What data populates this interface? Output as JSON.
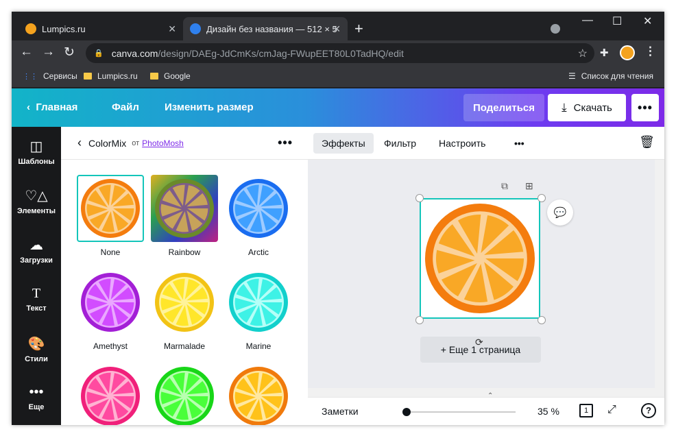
{
  "browser": {
    "tabs": [
      {
        "title": "Lumpics.ru",
        "icon": "lumpics-favicon"
      },
      {
        "title": "Дизайн без названия — 512 × 5",
        "icon": "canva-favicon"
      }
    ],
    "url_host": "canva.com",
    "url_path": "/design/DAEg-JdCmKs/cmJag-FWupEET80L0TadHQ/edit",
    "bookmarks": [
      "Сервисы",
      "Lumpics.ru",
      "Google"
    ],
    "reading_list": "Список для чтения"
  },
  "header": {
    "home": "Главная",
    "file": "Файл",
    "resize": "Изменить размер",
    "share": "Поделиться",
    "download": "Скачать"
  },
  "rail": [
    "Шаблоны",
    "Элементы",
    "Загрузки",
    "Текст",
    "Стили",
    "Еще"
  ],
  "panel": {
    "title": "ColorMix",
    "by": "от",
    "author": "PhotoMosh",
    "effects": [
      {
        "name": "None",
        "rind": "#f47c0e",
        "flesh": "#f9a826",
        "bg": "#fbd29a"
      },
      {
        "name": "Rainbow",
        "rind": "#6a8a2a",
        "flesh": "#c7a35a",
        "bg": "#7d5c8a"
      },
      {
        "name": "Arctic",
        "rind": "#1a6df0",
        "flesh": "#3fa0ff",
        "bg": "#9ecbff"
      },
      {
        "name": "Amethyst",
        "rind": "#a31fd6",
        "flesh": "#d24cff",
        "bg": "#eaa8ff"
      },
      {
        "name": "Marmalade",
        "rind": "#f2c315",
        "flesh": "#ffe62a",
        "bg": "#fff39a"
      },
      {
        "name": "Marine",
        "rind": "#12d0cc",
        "flesh": "#3ef2e6",
        "bg": "#b5fff8"
      },
      {
        "name": "",
        "rind": "#f0207a",
        "flesh": "#ff4aa0",
        "bg": "#ffb3d2"
      },
      {
        "name": "",
        "rind": "#18d618",
        "flesh": "#49ff3a",
        "bg": "#b8ffb0"
      },
      {
        "name": "",
        "rind": "#f07a0c",
        "flesh": "#ffc21a",
        "bg": "#ffe8a0"
      }
    ]
  },
  "editor": {
    "tabs": [
      "Эффекты",
      "Фильтр",
      "Настроить"
    ],
    "add_page": "+ Еще 1 страница",
    "notes": "Заметки",
    "zoom": "35 %",
    "page_count": "1"
  }
}
